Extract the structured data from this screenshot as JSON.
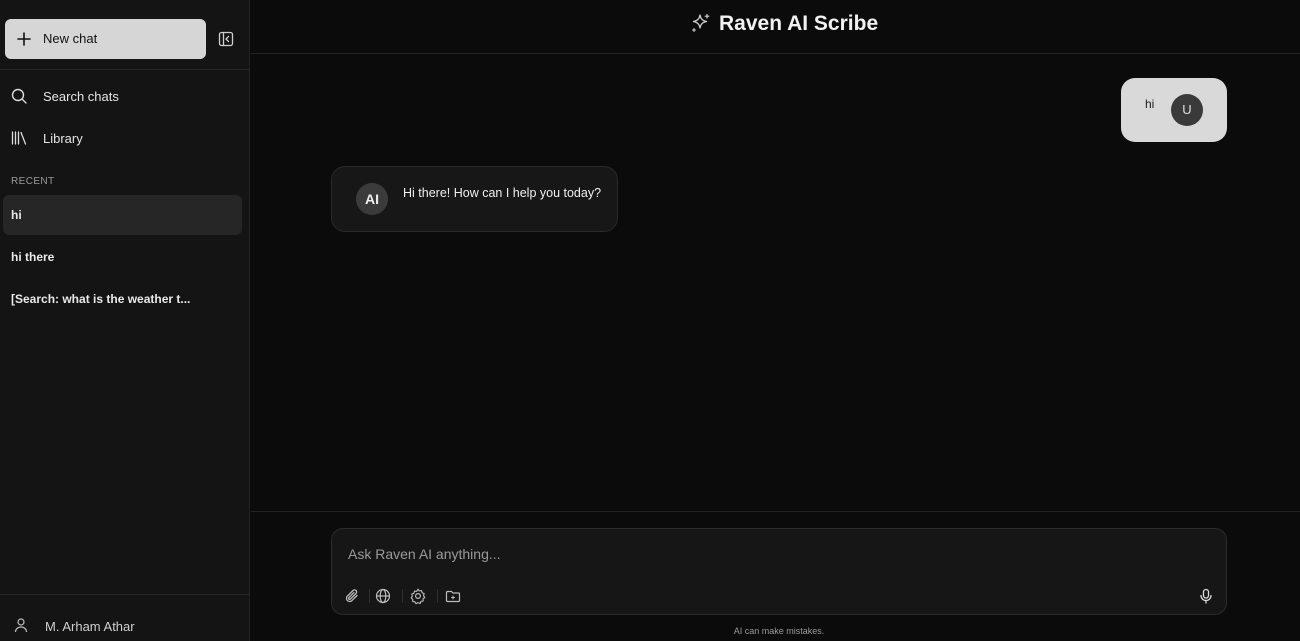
{
  "sidebar": {
    "new_chat_label": "New chat",
    "search_label": "Search chats",
    "library_label": "Library",
    "recent_label": "RECENT",
    "recent": [
      {
        "title": "hi",
        "active": true
      },
      {
        "title": "hi there",
        "active": false
      },
      {
        "title": "[Search: what is the weather t...",
        "active": false
      }
    ],
    "user_name": "M. Arham Athar"
  },
  "header": {
    "title": "Raven AI Scribe",
    "icon": "sparkle-icon"
  },
  "messages": [
    {
      "role": "user",
      "text": "hi",
      "avatar": "U"
    },
    {
      "role": "ai",
      "text": "Hi there! How can I help you today?",
      "avatar": "AI"
    }
  ],
  "composer": {
    "placeholder": "Ask Raven AI anything...",
    "value": "",
    "tools": [
      "paperclip-icon",
      "globe-icon",
      "settings-icon",
      "folder-icon"
    ],
    "disclaimer": "AI can make mistakes."
  },
  "colors": {
    "background": "#0b0b0b",
    "sidebar": "#141414",
    "new_chat_button": "#d6d6d6",
    "user_bubble": "#d9d9d9",
    "ai_bubble": "#171717"
  }
}
